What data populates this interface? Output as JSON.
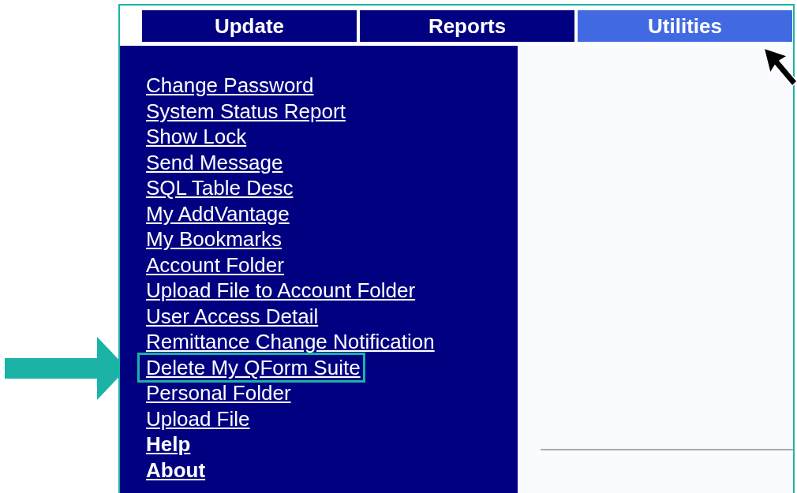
{
  "tabs": [
    {
      "label": "Update",
      "selected": false
    },
    {
      "label": "Reports",
      "selected": false
    },
    {
      "label": "Utilities",
      "selected": true
    }
  ],
  "menu": [
    {
      "label": "Change Password",
      "bold": false,
      "highlighted": false
    },
    {
      "label": "System Status Report",
      "bold": false,
      "highlighted": false
    },
    {
      "label": "Show Lock",
      "bold": false,
      "highlighted": false
    },
    {
      "label": "Send Message",
      "bold": false,
      "highlighted": false
    },
    {
      "label": "SQL Table Desc",
      "bold": false,
      "highlighted": false
    },
    {
      "label": "My AddVantage",
      "bold": false,
      "highlighted": false
    },
    {
      "label": "My Bookmarks",
      "bold": false,
      "highlighted": false
    },
    {
      "label": "Account Folder",
      "bold": false,
      "highlighted": false
    },
    {
      "label": "Upload File to Account Folder",
      "bold": false,
      "highlighted": false
    },
    {
      "label": "User Access Detail",
      "bold": false,
      "highlighted": false
    },
    {
      "label": "Remittance Change Notification",
      "bold": false,
      "highlighted": false
    },
    {
      "label": "Delete My QForm Suite",
      "bold": false,
      "highlighted": true
    },
    {
      "label": "Personal Folder",
      "bold": false,
      "highlighted": false
    },
    {
      "label": "Upload File",
      "bold": false,
      "highlighted": false
    },
    {
      "label": "Help",
      "bold": true,
      "highlighted": false
    },
    {
      "label": "About",
      "bold": true,
      "highlighted": false
    }
  ]
}
